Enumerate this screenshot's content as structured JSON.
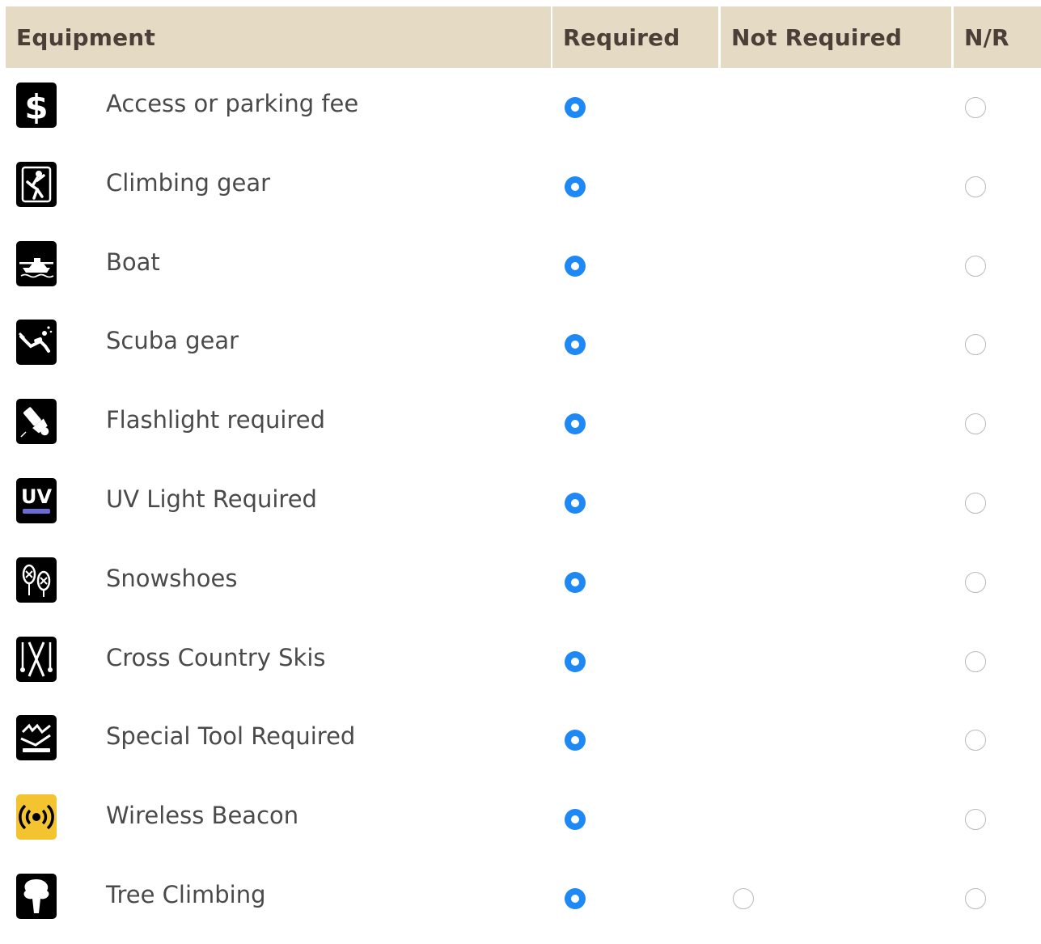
{
  "table": {
    "headers": {
      "equipment": "Equipment",
      "required": "Required",
      "not_required": "Not Required",
      "nr": "N/R"
    },
    "rows": [
      {
        "label": "Access or parking fee",
        "icon": "dollar-icon",
        "required": true,
        "not_required_shown": false,
        "nr": false
      },
      {
        "label": "Climbing gear",
        "icon": "climber-icon",
        "required": true,
        "not_required_shown": false,
        "nr": false
      },
      {
        "label": "Boat",
        "icon": "boat-icon",
        "required": true,
        "not_required_shown": false,
        "nr": false
      },
      {
        "label": "Scuba gear",
        "icon": "scuba-icon",
        "required": true,
        "not_required_shown": false,
        "nr": false
      },
      {
        "label": "Flashlight required",
        "icon": "flashlight-icon",
        "required": true,
        "not_required_shown": false,
        "nr": false
      },
      {
        "label": "UV Light Required",
        "icon": "uv-light-icon",
        "icon_text": "UV",
        "required": true,
        "not_required_shown": false,
        "nr": false
      },
      {
        "label": "Snowshoes",
        "icon": "snowshoes-icon",
        "required": true,
        "not_required_shown": false,
        "nr": false
      },
      {
        "label": "Cross Country Skis",
        "icon": "skis-icon",
        "required": true,
        "not_required_shown": false,
        "nr": false
      },
      {
        "label": "Special Tool Required",
        "icon": "special-tool-icon",
        "required": true,
        "not_required_shown": false,
        "nr": false
      },
      {
        "label": "Wireless Beacon",
        "icon": "wireless-beacon-icon",
        "required": true,
        "not_required_shown": false,
        "nr": false
      },
      {
        "label": "Tree Climbing",
        "icon": "tree-icon",
        "required": true,
        "not_required_shown": true,
        "nr": false
      }
    ]
  },
  "colors": {
    "header_bg": "#e5dac3",
    "radio_checked": "#1e88f5",
    "beacon_bg": "#f4c430"
  }
}
